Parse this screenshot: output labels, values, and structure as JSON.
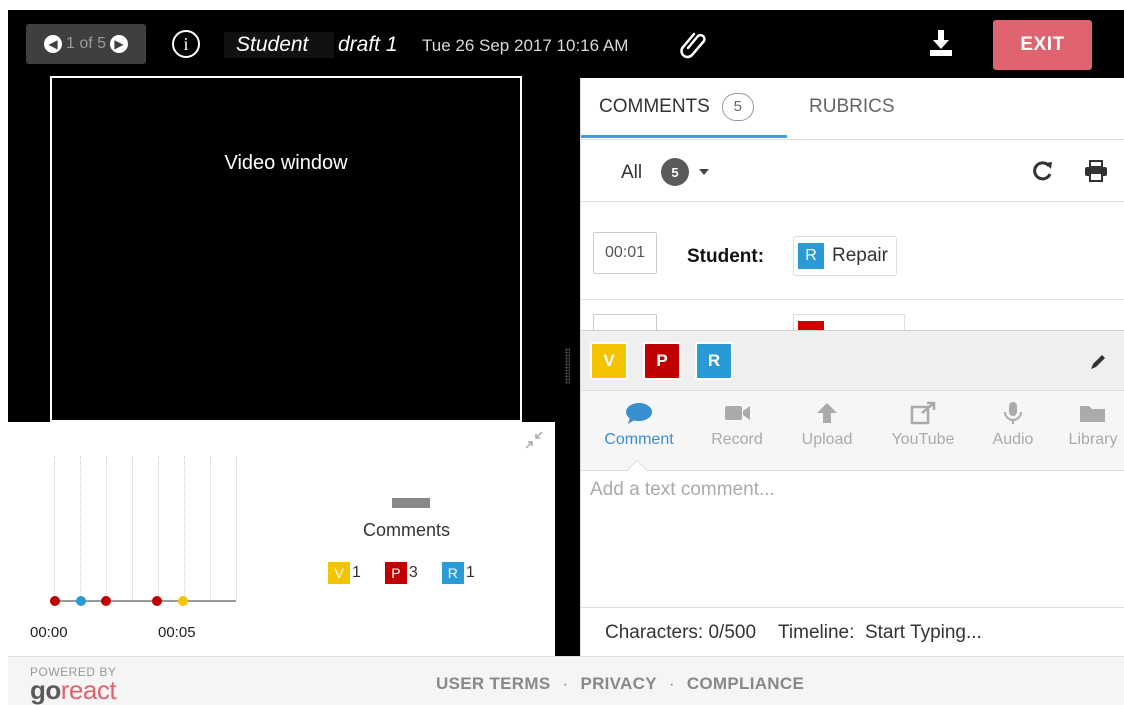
{
  "header": {
    "pager": "1 of 5",
    "student_name": "Student",
    "draft": "draft 1",
    "datetime": "Tue 26 Sep 2017 10:16 AM",
    "exit_label": "EXIT"
  },
  "video": {
    "label": "Video window"
  },
  "timeline": {
    "start_label": "00:00",
    "mid_label": "00:05",
    "legend_title": "Comments",
    "legend": [
      {
        "letter": "V",
        "count": "1",
        "color": "#f5c400"
      },
      {
        "letter": "P",
        "count": "3",
        "color": "#c00000"
      },
      {
        "letter": "R",
        "count": "1",
        "color": "#2a9ad6"
      }
    ]
  },
  "tabs": {
    "comments_label": "COMMENTS",
    "comments_count": "5",
    "rubrics_label": "RUBRICS"
  },
  "filter": {
    "label": "All",
    "count": "5"
  },
  "comments": [
    {
      "time": "00:01",
      "author": "Student:",
      "tag_letter": "R",
      "tag_label": "Repair"
    }
  ],
  "markers": [
    {
      "letter": "V",
      "color": "#f5c400"
    },
    {
      "letter": "P",
      "color": "#c00000"
    },
    {
      "letter": "R",
      "color": "#2a9ad6"
    }
  ],
  "tools": [
    {
      "label": "Comment",
      "icon": "comment-icon",
      "active": true
    },
    {
      "label": "Record",
      "icon": "camera-icon"
    },
    {
      "label": "Upload",
      "icon": "upload-arrow-icon"
    },
    {
      "label": "YouTube",
      "icon": "external-link-icon"
    },
    {
      "label": "Audio",
      "icon": "microphone-icon"
    },
    {
      "label": "Library",
      "icon": "folder-icon"
    }
  ],
  "composer": {
    "placeholder": "Add a text comment...",
    "characters": "Characters: 0/500",
    "timeline_status": "Timeline:  Start Typing..."
  },
  "footer": {
    "powered_by": "POWERED BY",
    "logo_go": "go",
    "logo_react": "react",
    "links": [
      "USER TERMS",
      "PRIVACY",
      "COMPLIANCE"
    ],
    "separator": "·"
  }
}
